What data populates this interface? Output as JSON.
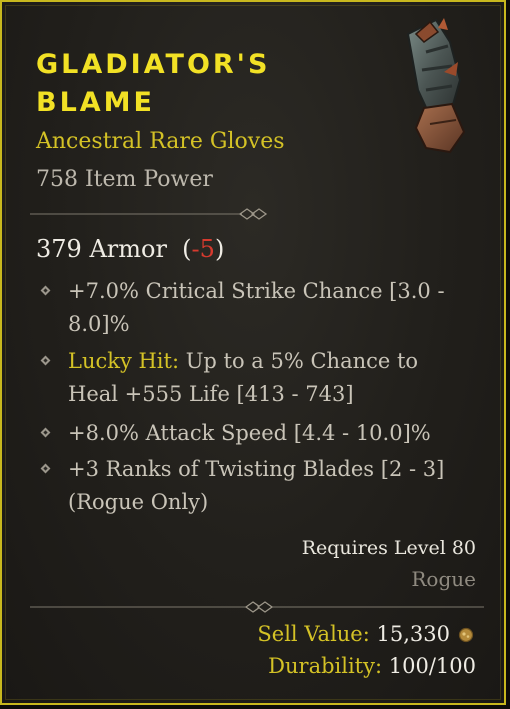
{
  "item": {
    "name": "Gladiator's Blame",
    "type_line": "Ancestral Rare Gloves",
    "item_power": "758 Item Power",
    "armor": "379 Armor",
    "armor_delta": "-5",
    "affixes": [
      {
        "text": "+7.0% Critical Strike Chance [3.0 - 8.0]%"
      },
      {
        "prefix": "Lucky Hit:",
        "text": " Up to a 5% Chance to Heal +555 Life [413 - 743]"
      },
      {
        "text": "+8.0% Attack Speed [4.4 - 10.0]%"
      },
      {
        "text": "+3 Ranks of Twisting Blades [2 - 3] (Rogue Only)"
      }
    ],
    "requirement": "Requires Level 80",
    "class": "Rogue",
    "sell_label": "Sell Value:",
    "sell_value": "15,330",
    "durability_label": "Durability:",
    "durability_value": "100/100"
  },
  "colors": {
    "border": "#c8b81e",
    "title": "#f2e125",
    "rare": "#d4c226",
    "negative": "#d63a2e"
  },
  "icons": [
    "gloves-icon",
    "gold-coin-icon",
    "affix-bullet-icon",
    "divider-ornament-icon"
  ]
}
